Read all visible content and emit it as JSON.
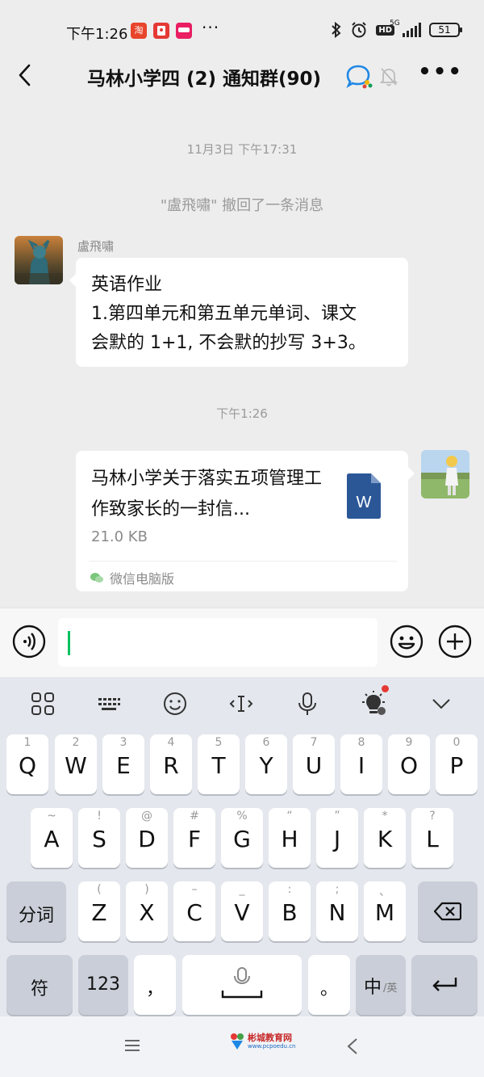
{
  "status_bar": {
    "time": "下午1:26",
    "app_badges": [
      {
        "name": "taobao",
        "text": "淘",
        "color": "#e8452c"
      },
      {
        "name": "red-packet",
        "text": "",
        "color": "#e53935"
      },
      {
        "name": "shop-app",
        "text": "",
        "color": "#e91e63"
      }
    ],
    "more": "···",
    "network": "5G",
    "hd": "HD",
    "battery": "51"
  },
  "header": {
    "title": "马林小学四 (2) 通知群(90)"
  },
  "chat": {
    "timestamp_1": "11月3日 下午17:31",
    "recall_notice": "\"盧飛嘯\" 撤回了一条消息",
    "sender_name": "盧飛嘯",
    "message_lines": [
      "英语作业",
      "1.第四单元和第五单元单词、课文",
      "会默的 1+1, 不会默的抄写 3+3。"
    ],
    "timestamp_2": "下午1:26",
    "file": {
      "name": "马林小学关于落实五项管理工作致家长的一封信...",
      "size": "21.0 KB",
      "icon_letter": "W",
      "source": "微信电脑版"
    }
  },
  "input": {
    "value": ""
  },
  "keyboard": {
    "row1": [
      {
        "hint": "1",
        "key": "Q"
      },
      {
        "hint": "2",
        "key": "W"
      },
      {
        "hint": "3",
        "key": "E"
      },
      {
        "hint": "4",
        "key": "R"
      },
      {
        "hint": "5",
        "key": "T"
      },
      {
        "hint": "6",
        "key": "Y"
      },
      {
        "hint": "7",
        "key": "U"
      },
      {
        "hint": "8",
        "key": "I"
      },
      {
        "hint": "9",
        "key": "O"
      },
      {
        "hint": "0",
        "key": "P"
      }
    ],
    "row2": [
      {
        "hint": "~",
        "key": "A"
      },
      {
        "hint": "!",
        "key": "S"
      },
      {
        "hint": "@",
        "key": "D"
      },
      {
        "hint": "#",
        "key": "F"
      },
      {
        "hint": "%",
        "key": "G"
      },
      {
        "hint": "“",
        "key": "H"
      },
      {
        "hint": "”",
        "key": "J"
      },
      {
        "hint": "*",
        "key": "K"
      },
      {
        "hint": "?",
        "key": "L"
      }
    ],
    "row3": [
      {
        "hint": "(",
        "key": "Z"
      },
      {
        "hint": ")",
        "key": "X"
      },
      {
        "hint": "–",
        "key": "C"
      },
      {
        "hint": "_",
        "key": "V"
      },
      {
        "hint": ":",
        "key": "B"
      },
      {
        "hint": ";",
        "key": "N"
      },
      {
        "hint": "、",
        "key": "M"
      }
    ],
    "fenci": "分词",
    "symbols": "符",
    "numbers": "123",
    "comma": "，",
    "period": "。",
    "lang_main": "中",
    "lang_sub": "/英"
  },
  "system_nav": {
    "logo_text": "彬城教育网",
    "logo_sub": "www.pcpoedu.cn"
  }
}
